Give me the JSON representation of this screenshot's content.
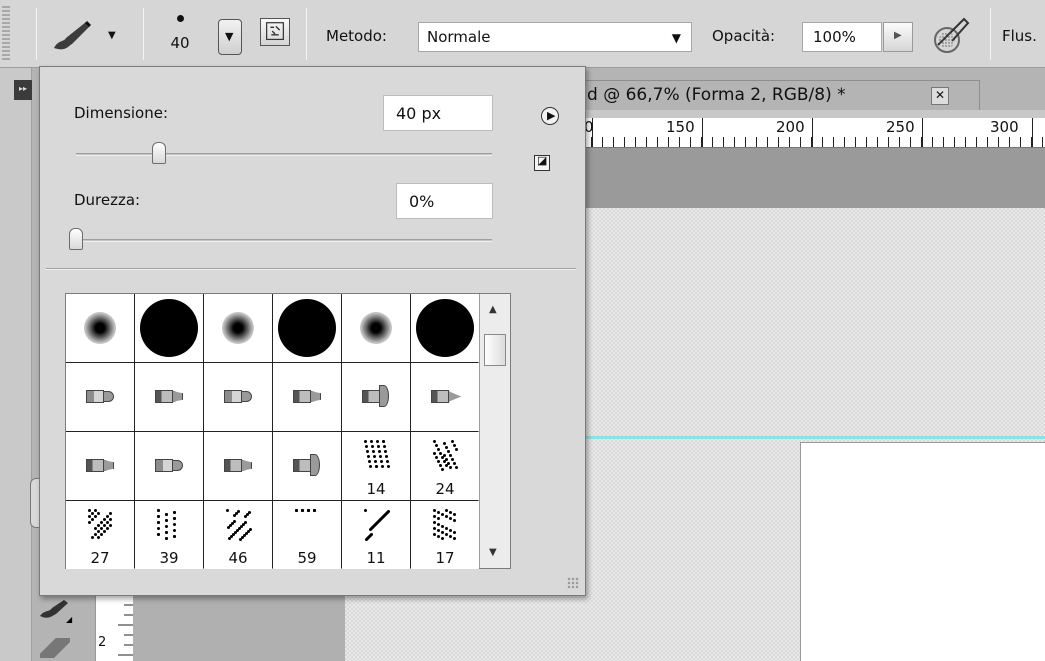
{
  "options_bar": {
    "tool_preset_icon": "brush-icon",
    "brush_size": "40",
    "mode_label": "Metodo:",
    "mode_value": "Normale",
    "opacity_label": "Opacità:",
    "opacity_value": "100%",
    "flow_label": "Flus."
  },
  "document": {
    "tab_title": "d @ 66,7% (Forma 2, RGB/8) *",
    "ruler_h_labels": [
      "0",
      "150",
      "200",
      "250",
      "300"
    ],
    "ruler_v_labels": [
      "2"
    ]
  },
  "brush_popup": {
    "size_label": "Dimensione:",
    "size_value": "40 px",
    "size_slider_fraction": 0.2,
    "hardness_label": "Durezza:",
    "hardness_value": "0%",
    "hardness_slider_fraction": 0.0,
    "presets": [
      {
        "type": "soft-round",
        "size": ""
      },
      {
        "type": "hard-round",
        "size": ""
      },
      {
        "type": "soft-round",
        "size": ""
      },
      {
        "type": "hard-round",
        "size": ""
      },
      {
        "type": "soft-round",
        "size": ""
      },
      {
        "type": "hard-round",
        "size": ""
      },
      {
        "type": "bristle-round",
        "size": ""
      },
      {
        "type": "bristle-flat",
        "size": ""
      },
      {
        "type": "bristle-round",
        "size": ""
      },
      {
        "type": "bristle-angle",
        "size": ""
      },
      {
        "type": "bristle-fan",
        "size": ""
      },
      {
        "type": "bristle-point",
        "size": ""
      },
      {
        "type": "bristle-flat",
        "size": ""
      },
      {
        "type": "bristle-round",
        "size": ""
      },
      {
        "type": "bristle-angle",
        "size": ""
      },
      {
        "type": "bristle-fan",
        "size": ""
      },
      {
        "type": "scatter",
        "size": "14"
      },
      {
        "type": "scatter",
        "size": "24"
      },
      {
        "type": "scatter",
        "size": "27"
      },
      {
        "type": "scatter",
        "size": "39"
      },
      {
        "type": "scatter",
        "size": "46"
      },
      {
        "type": "scatter",
        "size": "59"
      },
      {
        "type": "scatter",
        "size": "11"
      },
      {
        "type": "scatter",
        "size": "17"
      }
    ]
  }
}
